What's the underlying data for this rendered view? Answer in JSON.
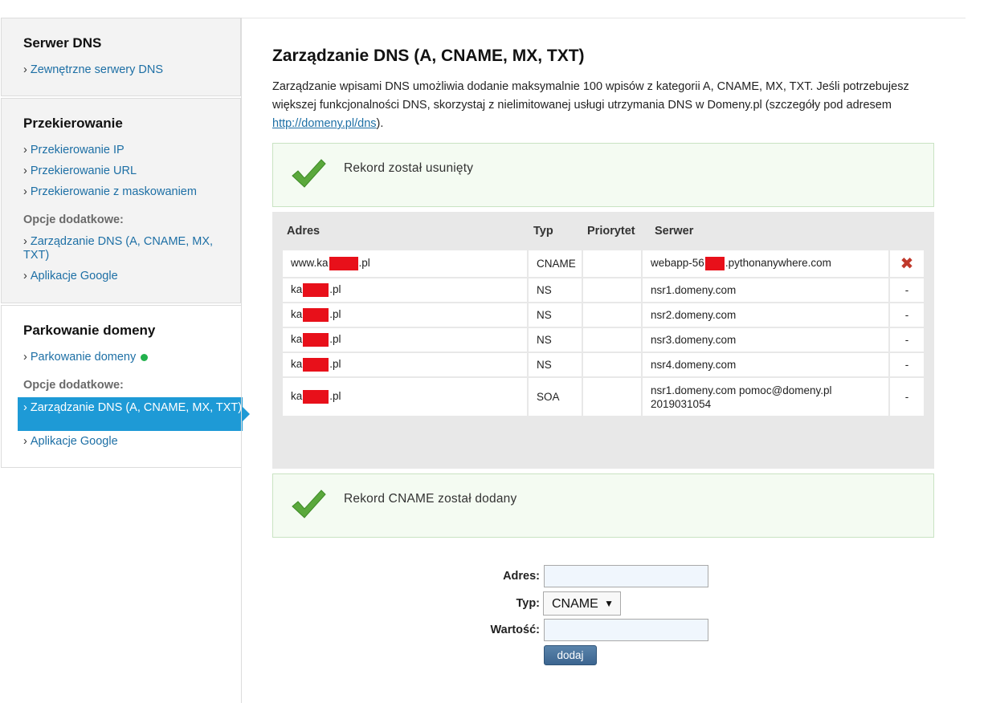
{
  "sidebar": {
    "dns_servers": {
      "title": "Serwer DNS",
      "links": [
        "Zewnętrzne serwery DNS"
      ]
    },
    "redirect": {
      "title": "Przekierowanie",
      "links": [
        "Przekierowanie IP",
        "Przekierowanie URL",
        "Przekierowanie z maskowaniem"
      ],
      "extras_label": "Opcje dodatkowe:",
      "extras": [
        "Zarządzanie DNS (A, CNAME, MX, TXT)",
        "Aplikacje Google"
      ]
    },
    "parking": {
      "title": "Parkowanie domeny",
      "link": "Parkowanie domeny",
      "extras_label": "Opcje dodatkowe:",
      "active_item": "Zarządzanie DNS (A, CNAME, MX, TXT)",
      "extra_last": "Aplikacje Google"
    },
    "chevron": "›"
  },
  "main": {
    "title": "Zarządzanie DNS (A, CNAME, MX, TXT)",
    "intro_text": "Zarządzanie wpisami DNS umożliwia dodanie maksymalnie 100 wpisów z kategorii A, CNAME, MX, TXT. Jeśli potrzebujesz większej funkcjonalności DNS, skorzystaj z nielimitowanej usługi utrzymania DNS w Domeny.pl (szczegóły pod adresem ",
    "intro_link": "http://domeny.pl/dns",
    "intro_end": ").",
    "alert_removed": "Rekord został usunięty",
    "alert_added": "Rekord CNAME został dodany"
  },
  "table": {
    "headers": {
      "address": "Adres",
      "type": "Typ",
      "priority": "Priorytet",
      "server": "Serwer"
    },
    "rows": [
      {
        "addr_pre": "www.ka",
        "addr_post": ".pl",
        "type": "CNAME",
        "priority": "",
        "srv_pre": "webapp-56",
        "srv_post": ".pythonanywhere.com",
        "action": "✖"
      },
      {
        "addr_pre": "ka",
        "addr_post": ".pl",
        "type": "NS",
        "priority": "",
        "srv_pre": "nsr1.domeny.com",
        "srv_post": "",
        "action": "-"
      },
      {
        "addr_pre": "ka",
        "addr_post": ".pl",
        "type": "NS",
        "priority": "",
        "srv_pre": "nsr2.domeny.com",
        "srv_post": "",
        "action": "-"
      },
      {
        "addr_pre": "ka",
        "addr_post": ".pl",
        "type": "NS",
        "priority": "",
        "srv_pre": "nsr3.domeny.com",
        "srv_post": "",
        "action": "-"
      },
      {
        "addr_pre": "ka",
        "addr_post": ".pl",
        "type": "NS",
        "priority": "",
        "srv_pre": "nsr4.domeny.com",
        "srv_post": "",
        "action": "-"
      },
      {
        "addr_pre": "ka",
        "addr_post": ".pl",
        "type": "SOA",
        "priority": "",
        "srv_pre": "nsr1.domeny.com pomoc@domeny.pl",
        "srv_line2": "2019031054",
        "srv_post": "",
        "action": "-"
      }
    ]
  },
  "form": {
    "address_label": "Adres:",
    "address_value": "",
    "type_label": "Typ:",
    "type_selected": "CNAME",
    "value_label": "Wartość:",
    "value_value": "",
    "submit_label": "dodaj"
  },
  "colors": {
    "link": "#1d6fa5",
    "active_bg": "#1e9ad6",
    "alert_bg": "#f4fbf2",
    "check_green": "#5aa83c",
    "redaction": "#e8101a",
    "delete": "#c0392b"
  }
}
